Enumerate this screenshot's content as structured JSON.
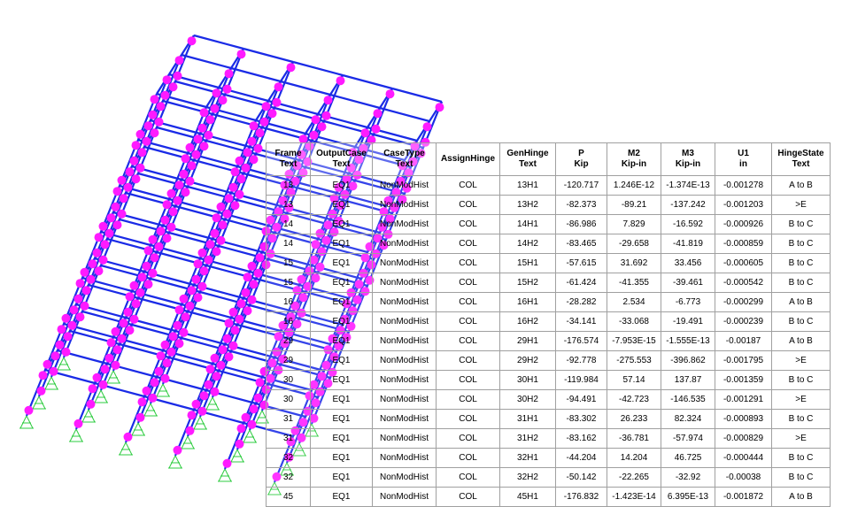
{
  "colors": {
    "frame": "#1a2be6",
    "hinge": "#ff1aff",
    "support": "#2ecc40",
    "grid_line": "#a0a0a0"
  },
  "table": {
    "headers": [
      {
        "line1": "Frame",
        "line2": "Text"
      },
      {
        "line1": "OutputCase",
        "line2": "Text"
      },
      {
        "line1": "CaseType",
        "line2": "Text"
      },
      {
        "line1": "AssignHinge",
        "line2": ""
      },
      {
        "line1": "GenHinge",
        "line2": "Text"
      },
      {
        "line1": "P",
        "line2": "Kip"
      },
      {
        "line1": "M2",
        "line2": "Kip-in"
      },
      {
        "line1": "M3",
        "line2": "Kip-in"
      },
      {
        "line1": "U1",
        "line2": "in"
      },
      {
        "line1": "HingeState",
        "line2": "Text"
      }
    ],
    "rows": [
      [
        "13",
        "EQ1",
        "NonModHist",
        "COL",
        "13H1",
        "-120.717",
        "1.246E-12",
        "-1.374E-13",
        "-0.001278",
        "A to B"
      ],
      [
        "13",
        "EQ1",
        "NonModHist",
        "COL",
        "13H2",
        "-82.373",
        "-89.21",
        "-137.242",
        "-0.001203",
        ">E"
      ],
      [
        "14",
        "EQ1",
        "NonModHist",
        "COL",
        "14H1",
        "-86.986",
        "7.829",
        "-16.592",
        "-0.000926",
        "B to C"
      ],
      [
        "14",
        "EQ1",
        "NonModHist",
        "COL",
        "14H2",
        "-83.465",
        "-29.658",
        "-41.819",
        "-0.000859",
        "B to C"
      ],
      [
        "15",
        "EQ1",
        "NonModHist",
        "COL",
        "15H1",
        "-57.615",
        "31.692",
        "33.456",
        "-0.000605",
        "B to C"
      ],
      [
        "15",
        "EQ1",
        "NonModHist",
        "COL",
        "15H2",
        "-61.424",
        "-41.355",
        "-39.461",
        "-0.000542",
        "B to C"
      ],
      [
        "16",
        "EQ1",
        "NonModHist",
        "COL",
        "16H1",
        "-28.282",
        "2.534",
        "-6.773",
        "-0.000299",
        "A to B"
      ],
      [
        "16",
        "EQ1",
        "NonModHist",
        "COL",
        "16H2",
        "-34.141",
        "-33.068",
        "-19.491",
        "-0.000239",
        "B to C"
      ],
      [
        "29",
        "EQ1",
        "NonModHist",
        "COL",
        "29H1",
        "-176.574",
        "-7.953E-15",
        "-1.555E-13",
        "-0.00187",
        "A to B"
      ],
      [
        "29",
        "EQ1",
        "NonModHist",
        "COL",
        "29H2",
        "-92.778",
        "-275.553",
        "-396.862",
        "-0.001795",
        ">E"
      ],
      [
        "30",
        "EQ1",
        "NonModHist",
        "COL",
        "30H1",
        "-119.984",
        "57.14",
        "137.87",
        "-0.001359",
        "B to C"
      ],
      [
        "30",
        "EQ1",
        "NonModHist",
        "COL",
        "30H2",
        "-94.491",
        "-42.723",
        "-146.535",
        "-0.001291",
        ">E"
      ],
      [
        "31",
        "EQ1",
        "NonModHist",
        "COL",
        "31H1",
        "-83.302",
        "26.233",
        "82.324",
        "-0.000893",
        "B to C"
      ],
      [
        "31",
        "EQ1",
        "NonModHist",
        "COL",
        "31H2",
        "-83.162",
        "-36.781",
        "-57.974",
        "-0.000829",
        ">E"
      ],
      [
        "32",
        "EQ1",
        "NonModHist",
        "COL",
        "32H1",
        "-44.204",
        "14.204",
        "46.725",
        "-0.000444",
        "B to C"
      ],
      [
        "32",
        "EQ1",
        "NonModHist",
        "COL",
        "32H2",
        "-50.142",
        "-22.265",
        "-32.92",
        "-0.00038",
        "B to C"
      ],
      [
        "45",
        "EQ1",
        "NonModHist",
        "COL",
        "45H1",
        "-176.832",
        "-1.423E-14",
        "6.395E-13",
        "-0.001872",
        "A to B"
      ]
    ]
  }
}
